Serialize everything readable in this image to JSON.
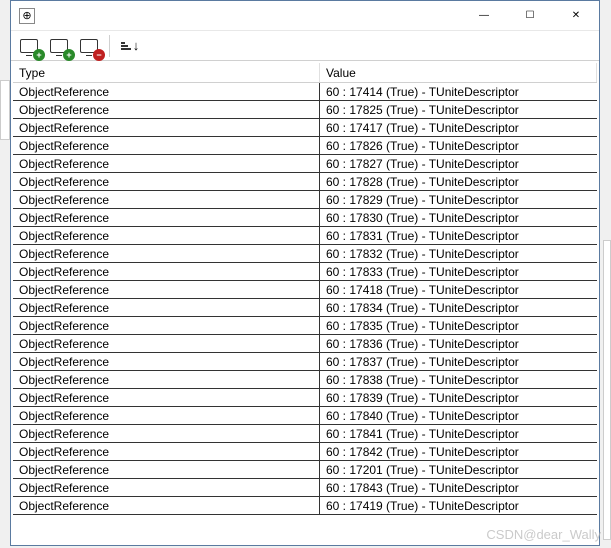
{
  "titlebar": {
    "icon_glyph": "⊕"
  },
  "win_controls": {
    "min": "—",
    "max": "☐",
    "close": "✕"
  },
  "toolbar": {
    "add1_name": "add-watch-icon",
    "add2_name": "add-watch-icon",
    "remove_name": "remove-watch-icon",
    "sort_name": "sort-icon"
  },
  "columns": {
    "type": "Type",
    "value": "Value"
  },
  "rows": [
    {
      "type": "ObjectReference",
      "value": "60 : 17414 (True) - TUniteDescriptor"
    },
    {
      "type": "ObjectReference",
      "value": "60 : 17825 (True) - TUniteDescriptor"
    },
    {
      "type": "ObjectReference",
      "value": "60 : 17417 (True) - TUniteDescriptor"
    },
    {
      "type": "ObjectReference",
      "value": "60 : 17826 (True) - TUniteDescriptor"
    },
    {
      "type": "ObjectReference",
      "value": "60 : 17827 (True) - TUniteDescriptor"
    },
    {
      "type": "ObjectReference",
      "value": "60 : 17828 (True) - TUniteDescriptor"
    },
    {
      "type": "ObjectReference",
      "value": "60 : 17829 (True) - TUniteDescriptor"
    },
    {
      "type": "ObjectReference",
      "value": "60 : 17830 (True) - TUniteDescriptor"
    },
    {
      "type": "ObjectReference",
      "value": "60 : 17831 (True) - TUniteDescriptor"
    },
    {
      "type": "ObjectReference",
      "value": "60 : 17832 (True) - TUniteDescriptor"
    },
    {
      "type": "ObjectReference",
      "value": "60 : 17833 (True) - TUniteDescriptor"
    },
    {
      "type": "ObjectReference",
      "value": "60 : 17418 (True) - TUniteDescriptor"
    },
    {
      "type": "ObjectReference",
      "value": "60 : 17834 (True) - TUniteDescriptor"
    },
    {
      "type": "ObjectReference",
      "value": "60 : 17835 (True) - TUniteDescriptor"
    },
    {
      "type": "ObjectReference",
      "value": "60 : 17836 (True) - TUniteDescriptor"
    },
    {
      "type": "ObjectReference",
      "value": "60 : 17837 (True) - TUniteDescriptor"
    },
    {
      "type": "ObjectReference",
      "value": "60 : 17838 (True) - TUniteDescriptor"
    },
    {
      "type": "ObjectReference",
      "value": "60 : 17839 (True) - TUniteDescriptor"
    },
    {
      "type": "ObjectReference",
      "value": "60 : 17840 (True) - TUniteDescriptor"
    },
    {
      "type": "ObjectReference",
      "value": "60 : 17841 (True) - TUniteDescriptor"
    },
    {
      "type": "ObjectReference",
      "value": "60 : 17842 (True) - TUniteDescriptor"
    },
    {
      "type": "ObjectReference",
      "value": "60 : 17201 (True) - TUniteDescriptor"
    },
    {
      "type": "ObjectReference",
      "value": "60 : 17843 (True) - TUniteDescriptor"
    },
    {
      "type": "ObjectReference",
      "value": "60 : 17419 (True) - TUniteDescriptor"
    }
  ],
  "watermark": "CSDN@dear_Wally"
}
